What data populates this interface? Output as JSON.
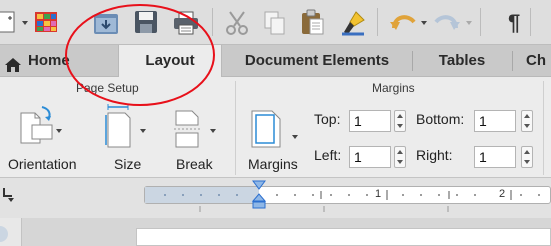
{
  "toolbar": {
    "icons": [
      "new-document-icon",
      "gallery-icon",
      "open-icon",
      "save-icon",
      "print-icon",
      "cut-icon",
      "copy-icon",
      "paste-icon",
      "format-painter-icon",
      "undo-icon",
      "redo-icon",
      "pilcrow-icon"
    ],
    "pilcrow_glyph": "¶"
  },
  "tabs": {
    "home": "Home",
    "layout": "Layout",
    "document_elements": "Document Elements",
    "tables": "Tables",
    "charts": "Ch"
  },
  "ribbon": {
    "page_setup": {
      "title": "Page Setup",
      "orientation": "Orientation",
      "size": "Size",
      "break": "Break"
    },
    "margins": {
      "title": "Margins",
      "margins_button": "Margins",
      "top_label": "Top:",
      "top_value": "1",
      "bottom_label": "Bottom:",
      "bottom_value": "1",
      "left_label": "Left:",
      "left_value": "1",
      "right_label": "Right:",
      "right_value": "1"
    }
  },
  "ruler": {
    "mark_1": "1",
    "mark_2": "2"
  },
  "colors": {
    "annotation_circle": "#e8101a",
    "selected_tab_bg": "#ececec",
    "ribbon_bg": "#ececec"
  }
}
